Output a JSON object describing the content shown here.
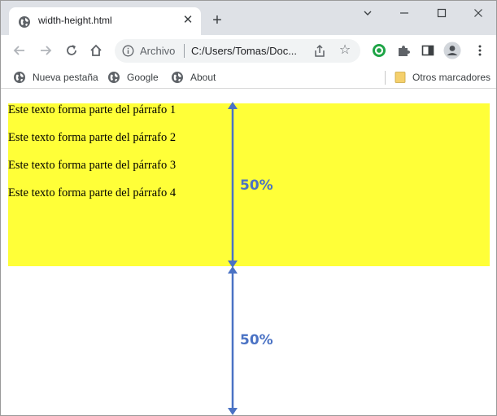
{
  "tab": {
    "title": "width-height.html",
    "close": "✕",
    "new_tab": "+"
  },
  "window_controls": {
    "dropdown": "⌄",
    "minimize": "–",
    "maximize": "☐",
    "close": "✕"
  },
  "address_bar": {
    "scheme_label": "Archivo",
    "url": "C:/Users/Tomas/Doc..."
  },
  "bookmarks": {
    "items": [
      {
        "label": "Nueva pestaña",
        "icon": "globe-icon"
      },
      {
        "label": "Google",
        "icon": "globe-icon"
      },
      {
        "label": "About",
        "icon": "globe-icon"
      }
    ],
    "other": {
      "label": "Otros marcadores",
      "icon": "folder-icon"
    }
  },
  "page": {
    "paragraphs": [
      "Este texto forma parte del párrafo 1",
      "Este texto forma parte del párrafo 2",
      "Este texto forma parte del párrafo 3",
      "Este texto forma parte del párrafo 4"
    ],
    "block_color": "#ffff38"
  },
  "annotation": {
    "top_label": "50%",
    "bottom_label": "50%",
    "color": "#4a72c4"
  }
}
